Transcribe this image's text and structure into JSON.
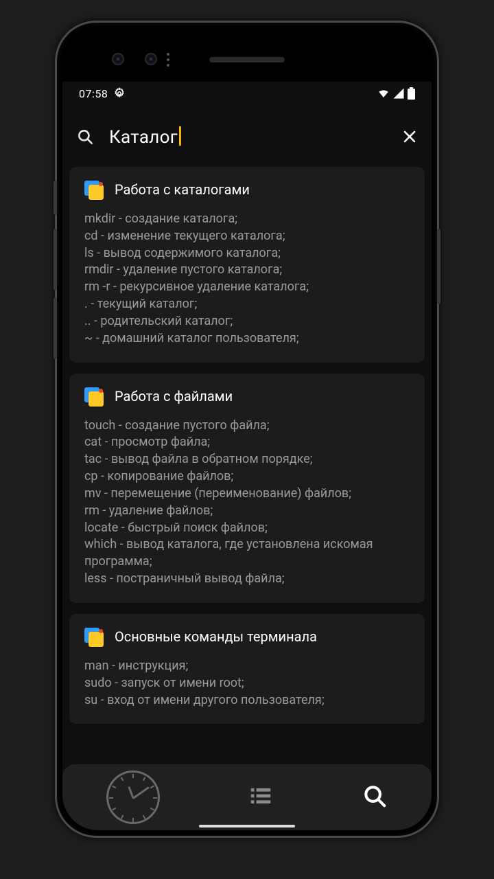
{
  "statusbar": {
    "time": "07:58"
  },
  "search": {
    "query": "Каталог"
  },
  "cards": [
    {
      "title": "Работа с каталогами",
      "body": "mkdir - создание каталога;\ncd - изменение текущего каталога;\nls - вывод содержимого каталога;\nrmdir - удаление пустого каталога;\nrm -r - рекурсивное удаление каталога;\n. - текущий каталог;\n.. - родительский каталог;\n~ - домашний каталог пользователя;"
    },
    {
      "title": "Работа с файлами",
      "body": "touch - создание пустого файла;\ncat - просмотр файла;\ntac - вывод файла в обратном порядке;\ncp - копирование файлов;\nmv - перемещение (переименование) файлов;\nrm - удаление файлов;\nlocate - быстрый поиск файлов;\nwhich - вывод каталога, где установлена искомая программа;\nless - постраничный вывод файла;"
    },
    {
      "title": "Основные команды терминала",
      "body": "man - инструкция;\nsudo - запуск от имени root;\nsu - вход от имени другого пользователя;"
    }
  ]
}
